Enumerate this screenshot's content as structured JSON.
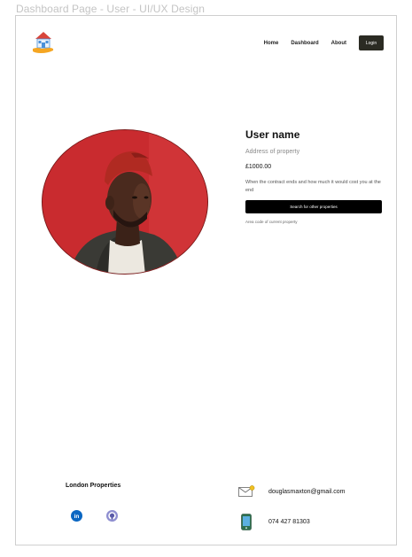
{
  "caption": "Dashboard Page - User - UI/UX Design",
  "nav": {
    "home": "Home",
    "dashboard": "Dashboard",
    "about": "About",
    "login": "Login"
  },
  "logo": {
    "icon": "house-in-hand-icon",
    "colors": {
      "roof": "#d9463b",
      "house": "#4a90d9",
      "hand": "#f5a623"
    }
  },
  "profile": {
    "user_name": "User name",
    "address": "Address of property",
    "price": "£1000.00",
    "contract_note": "When the contract ends and how much it would cost you at the end",
    "search_button": "Search for other properties",
    "area_code": "Area code of current property"
  },
  "footer": {
    "brand": "London Properties",
    "linkedin_icon": "linkedin-icon",
    "github_icon": "github-icon",
    "email": "douglasmaxton@gmail.com",
    "phone": "074 427 81303"
  },
  "colors": {
    "accent_dark": "#2b2b23",
    "button_black": "#000000",
    "photo_bg": "#c62a2e",
    "linkedin": "#0a66c2",
    "github": "#8e8ed0"
  }
}
